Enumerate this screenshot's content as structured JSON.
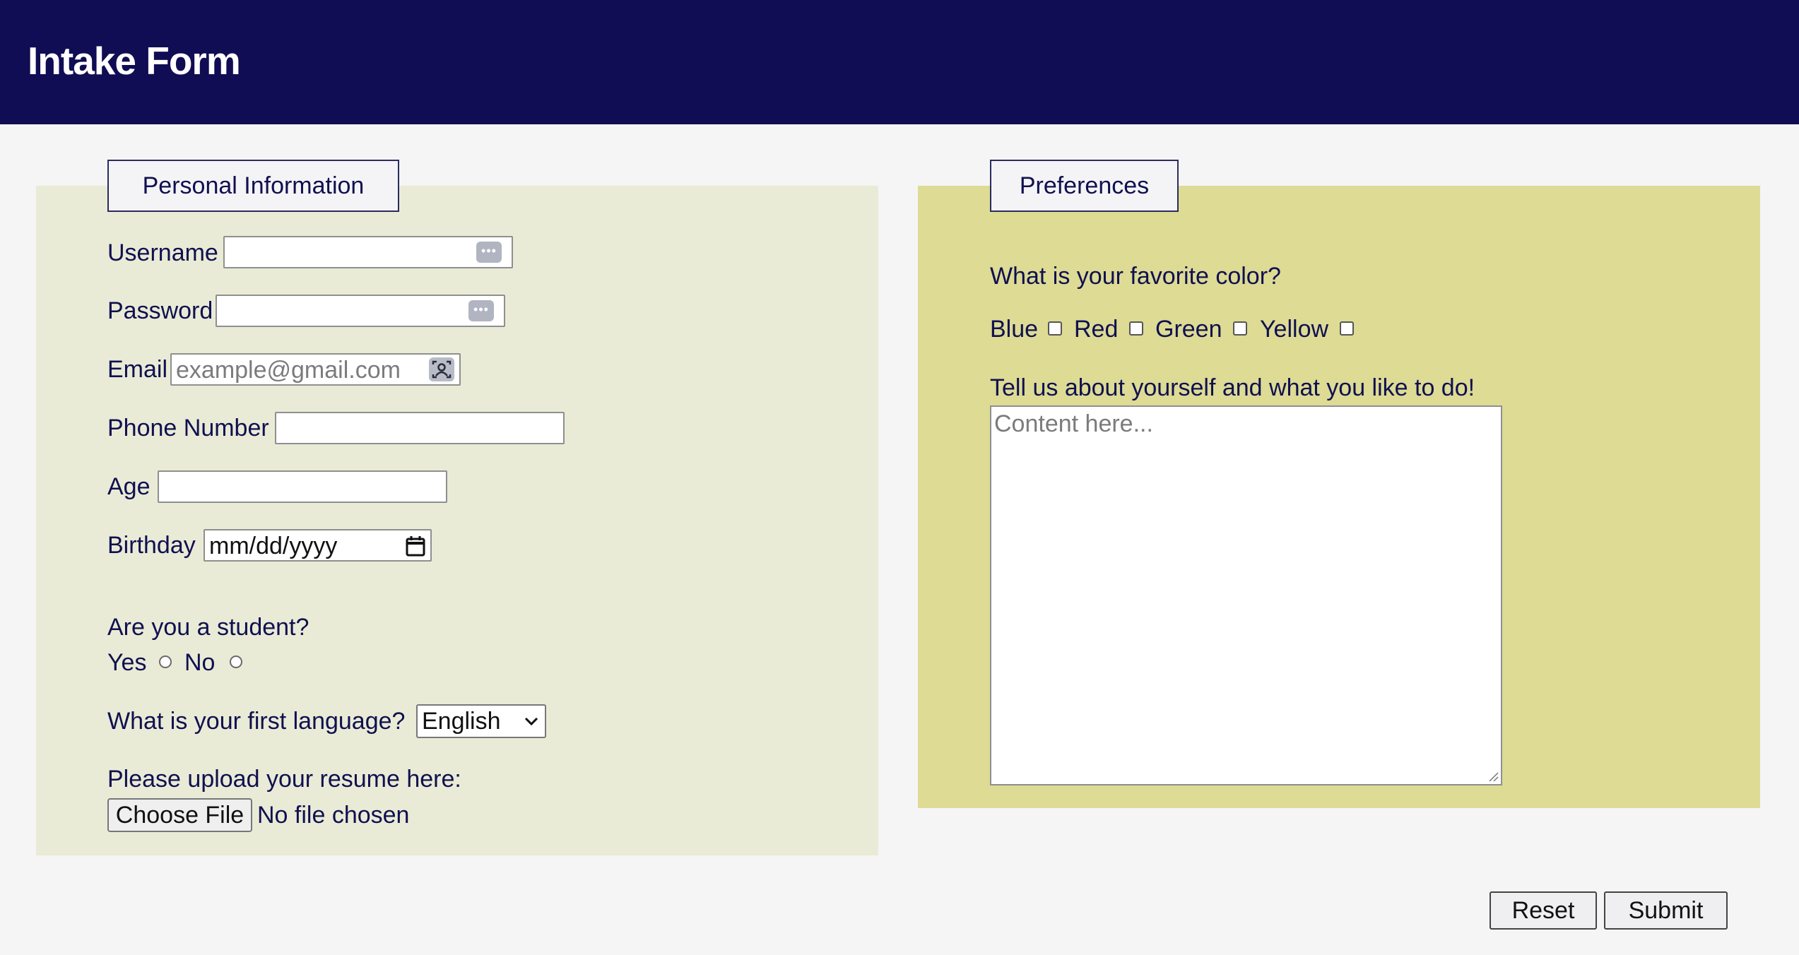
{
  "header": {
    "title": "Intake Form"
  },
  "personal": {
    "legend": "Personal Information",
    "username_label": "Username",
    "password_label": "Password",
    "email_label": "Email",
    "email_placeholder": "example@gmail.com",
    "phone_label": "Phone Number",
    "age_label": "Age",
    "birthday_label": "Birthday",
    "birthday_placeholder": "mm/dd/yyyy",
    "student_question": "Are you a student?",
    "student_yes": "Yes",
    "student_no": "No",
    "language_question": "What is your first language?",
    "language_selected": "English",
    "resume_label": "Please upload your resume here:",
    "choose_file_label": "Choose File",
    "no_file_text": "No file chosen"
  },
  "preferences": {
    "legend": "Preferences",
    "color_question": "What is your favorite color?",
    "colors": [
      "Blue",
      "Red",
      "Green",
      "Yellow"
    ],
    "about_label": "Tell us about yourself and what you like to do!",
    "about_placeholder": "Content here..."
  },
  "actions": {
    "reset_label": "Reset",
    "submit_label": "Submit"
  },
  "theme": {
    "header_bg": "#100d54",
    "left_panel_bg": "#e9ebd6",
    "right_panel_bg": "#dddb94",
    "text": "#101050"
  }
}
